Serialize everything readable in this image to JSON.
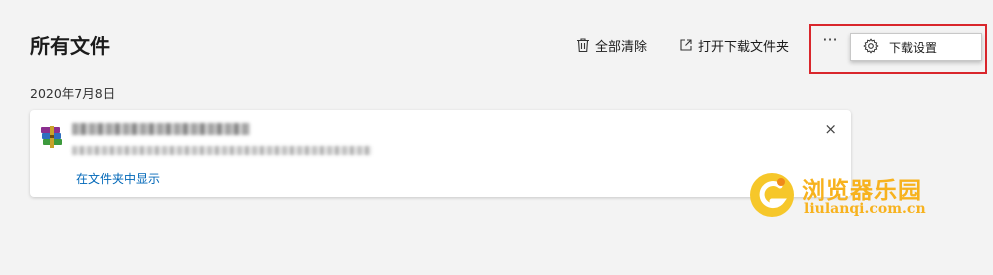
{
  "header": {
    "title": "所有文件",
    "clear_all_label": "全部清除",
    "open_folder_label": "打开下载文件夹",
    "more_label": "···"
  },
  "menu": {
    "download_settings_label": "下载设置"
  },
  "downloads": {
    "date_group": "2020年7月8日",
    "items": [
      {
        "action_label": "在文件夹中显示",
        "close_label": "×"
      }
    ]
  },
  "watermark": {
    "title": "浏览器乐园",
    "url": "liulanqi.com.cn"
  },
  "colors": {
    "background": "#f3f3f3",
    "link": "#0067b8",
    "highlight": "#d9262c",
    "watermark": "#f7b21e"
  }
}
